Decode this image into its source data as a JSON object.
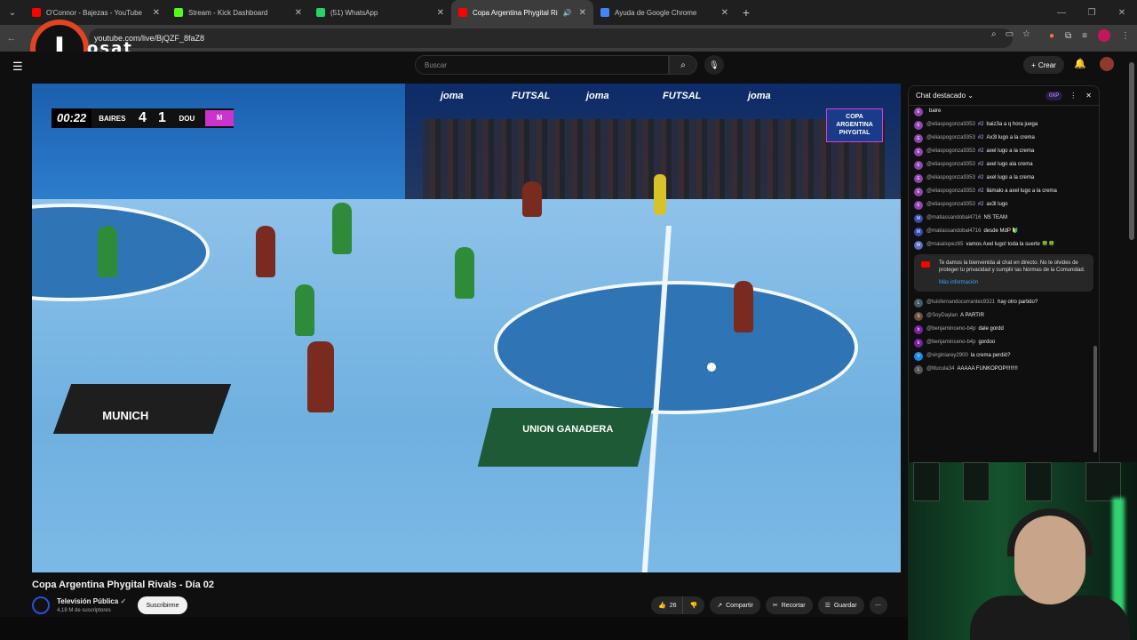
{
  "browser": {
    "tabs": [
      {
        "title": "O'Connor - Bajezas - YouTube",
        "color": "#ff0000",
        "active": false
      },
      {
        "title": "Stream - Kick Dashboard",
        "color": "#53fc18",
        "active": false
      },
      {
        "title": "(51) WhatsApp",
        "color": "#25d366",
        "active": false
      },
      {
        "title": "Copa Argentina Phygital Ri",
        "color": "#ff0000",
        "active": true
      },
      {
        "title": "Ayuda de Google Chrome",
        "color": "#4285f4",
        "active": false
      }
    ],
    "url": "youtube.com/live/BjQZF_8faZ8"
  },
  "watermark": {
    "letter": "I",
    "text": "osat"
  },
  "youtube": {
    "search_placeholder": "Buscar",
    "create_label": "Crear"
  },
  "video": {
    "scoreboard": {
      "time": "00:22",
      "home": "BAIRES",
      "home_score": "4",
      "away_score": "1",
      "away": "DOU"
    },
    "copa_badge": "COPA ARGENTINA PHYGITAL",
    "brands": [
      "joma",
      "FUTSAL",
      "joma",
      "FUTSAL",
      "joma"
    ],
    "decal_munich": "MUNICH",
    "decal_union": "UNION GANADERA",
    "title": "Copa Argentina Phygital Rivals - Día 02",
    "channel": "Televisión Pública",
    "subscribers": "4,18 M de suscriptores",
    "subscribe_label": "Suscribirme",
    "likes": "26",
    "share_label": "Compartir",
    "clip_label": "Recortar",
    "save_label": "Guardar"
  },
  "chat": {
    "header": "Chat destacado",
    "xp": "0XP",
    "messages": [
      {
        "author": "",
        "badge": "",
        "text": "baire",
        "avatar_letter": "E",
        "avatar_color": "#8e44ad"
      },
      {
        "author": "@eliaspogonza9353",
        "badge": "#2",
        "text": "baiz3a a q hora juega",
        "avatar_letter": "E",
        "avatar_color": "#8e44ad"
      },
      {
        "author": "@eliaspogonza9353",
        "badge": "#2",
        "text": "Ax3l lugo a la crema",
        "avatar_letter": "E",
        "avatar_color": "#8e44ad"
      },
      {
        "author": "@eliaspogonza9353",
        "badge": "#2",
        "text": "axel lugo a la crema",
        "avatar_letter": "E",
        "avatar_color": "#8e44ad"
      },
      {
        "author": "@eliaspogonza9353",
        "badge": "#2",
        "text": "axel lugo ala crema",
        "avatar_letter": "E",
        "avatar_color": "#8e44ad"
      },
      {
        "author": "@eliaspogonza9353",
        "badge": "#2",
        "text": "axel lugo a la crema",
        "avatar_letter": "E",
        "avatar_color": "#8e44ad"
      },
      {
        "author": "@eliaspogonza9353",
        "badge": "#2",
        "text": "llámalo a axel lugo a la crema",
        "avatar_letter": "E",
        "avatar_color": "#8e44ad"
      },
      {
        "author": "@eliaspogonza9353",
        "badge": "#2",
        "text": "ax3l lugo",
        "avatar_letter": "E",
        "avatar_color": "#8e44ad"
      },
      {
        "author": "@matiassandobal4716",
        "badge": "",
        "text": "NS TEAM",
        "avatar_letter": "M",
        "avatar_color": "#3949ab"
      },
      {
        "author": "@matiassandobal4716",
        "badge": "",
        "text": "desde MdP 🔰",
        "avatar_letter": "M",
        "avatar_color": "#3949ab"
      },
      {
        "author": "@maiaiiopez65",
        "badge": "",
        "text": "vamos Axel lugo! toda la suerte 🍀🍀",
        "avatar_letter": "M",
        "avatar_color": "#5c6bc0"
      }
    ],
    "notice": {
      "text": "Te damos la bienvenida al chat en directo. No te olvides de proteger tu privacidad y cumplir las Normas de la Comunidad.",
      "more": "Más información"
    },
    "messages2": [
      {
        "author": "@luisfernandocorrantes9321",
        "text": "hay otro partido?",
        "avatar_letter": "L",
        "avatar_color": "#455a64"
      },
      {
        "author": "@SoyDaylan",
        "text": "A PARTIR",
        "avatar_letter": "S",
        "avatar_color": "#6d4c41"
      },
      {
        "author": "@benjaminceno-b4p",
        "text": "dale gordd",
        "avatar_letter": "b",
        "avatar_color": "#7b1fa2"
      },
      {
        "author": "@benjaminceno-b4p",
        "text": "gordoo",
        "avatar_letter": "b",
        "avatar_color": "#7b1fa2"
      },
      {
        "author": "@virginiarey2900",
        "text": "la crema perdió?",
        "avatar_letter": "V",
        "avatar_color": "#1e88e5"
      },
      {
        "author": "@lltucula34",
        "text": "AAAAA FUNKOPOP!!!!!!!!",
        "avatar_letter": "L",
        "avatar_color": "#555555"
      }
    ]
  }
}
